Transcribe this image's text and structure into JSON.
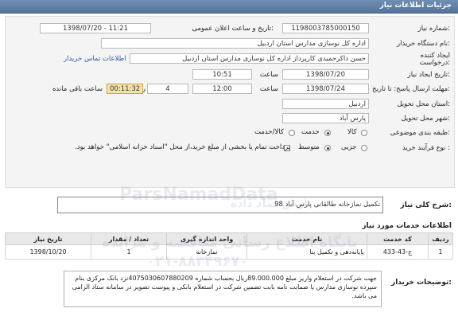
{
  "header": {
    "title": "جزئیات اطلاعات نیاز"
  },
  "form": {
    "need_number_label": "شماره نیاز:",
    "need_number": "1198003785000150",
    "announce_label": "تاریخ و ساعت اعلان عمومی:",
    "announce_value": "1398/07/20 - 11:21",
    "buyer_label": "نام دستگاه خریدار:",
    "buyer_value": "اداره کل نوسازی مدارس استان اردبیل",
    "creator_label": "ایجاد کننده درخواست:",
    "creator_value": "حسن ذاکرحمیدی کارپرداز اداره کل نوسازی مدارس استان اردبیل",
    "contact_link": "اطلاعات تماس خریدار",
    "create_date_label": "تاریخ ایجاد نیاز:",
    "create_date": "1398/07/20",
    "create_time_label": "ساعت",
    "create_time": "10:51",
    "deadline_label": "مهلت ارسال پاسخ: تا تاریخ:",
    "deadline_date": "1398/07/24",
    "deadline_time_label": "ساعت",
    "deadline_time": "12:00",
    "days_value": "4",
    "days_label": "روز و",
    "timer_value": "00:11:32",
    "remaining_label": "ساعت باقی مانده",
    "province_label": "استان محل تحویل:",
    "province_value": "اردبیل",
    "city_label": "شهر محل تحویل:",
    "city_value": "پارس آباد",
    "category_label": "طبقه بندی موضوعی:",
    "category_options": [
      "کالا",
      "خدمت",
      "کالا/خدمت"
    ],
    "purchase_label": "نوع فرآیند خرید :",
    "purchase_options": [
      "جزیی",
      "متوسط"
    ],
    "payment_note": "پرداخت تمام یا بخشی از مبلغ خرید،از محل \"اسناد خزانه اسلامی\" خواهد بود."
  },
  "summary": {
    "label": "شرح کلی نیاز:",
    "value": "تکمیل نمازخانه طالقانی پارس آباد 98"
  },
  "services": {
    "title": "اطلاعات خدمات مورد نیاز",
    "columns": [
      "ردیف",
      "کد خدمت",
      "نام خدمت",
      "واحد اندازه گیری",
      "تعداد / مقدار",
      "تاریخ نیاز"
    ],
    "rows": [
      {
        "row": "1",
        "code": "ج-43-433",
        "name": "پایانه‌دهی و تکمیل بنا",
        "unit": "نمازخانه",
        "qty": "1",
        "date": "1398/10/20"
      }
    ]
  },
  "buyer_notes": {
    "label": "توضیحات خریدار:",
    "text": "جهت شرکت در استعلام واریز مبلغ 89.000.000ریال بحساب شماره 4075030607880209نزد بانک مرکزی بنام سپرده نوسازی مدارس یا ضمانت نامه بابت تضمین شرکت در استعلام بانکی و پیوست تصویر در سامانه ستاد الزامی می باشد."
  },
  "watermark": {
    "line1": "ParsNamadData",
    "line2": "پایگاه اطلاع رسانی مناقصه و مزایده",
    "line3": "۰۲۱-۸۸۳۴۹۶۷۰",
    "line4": "پارس نماد داده"
  }
}
